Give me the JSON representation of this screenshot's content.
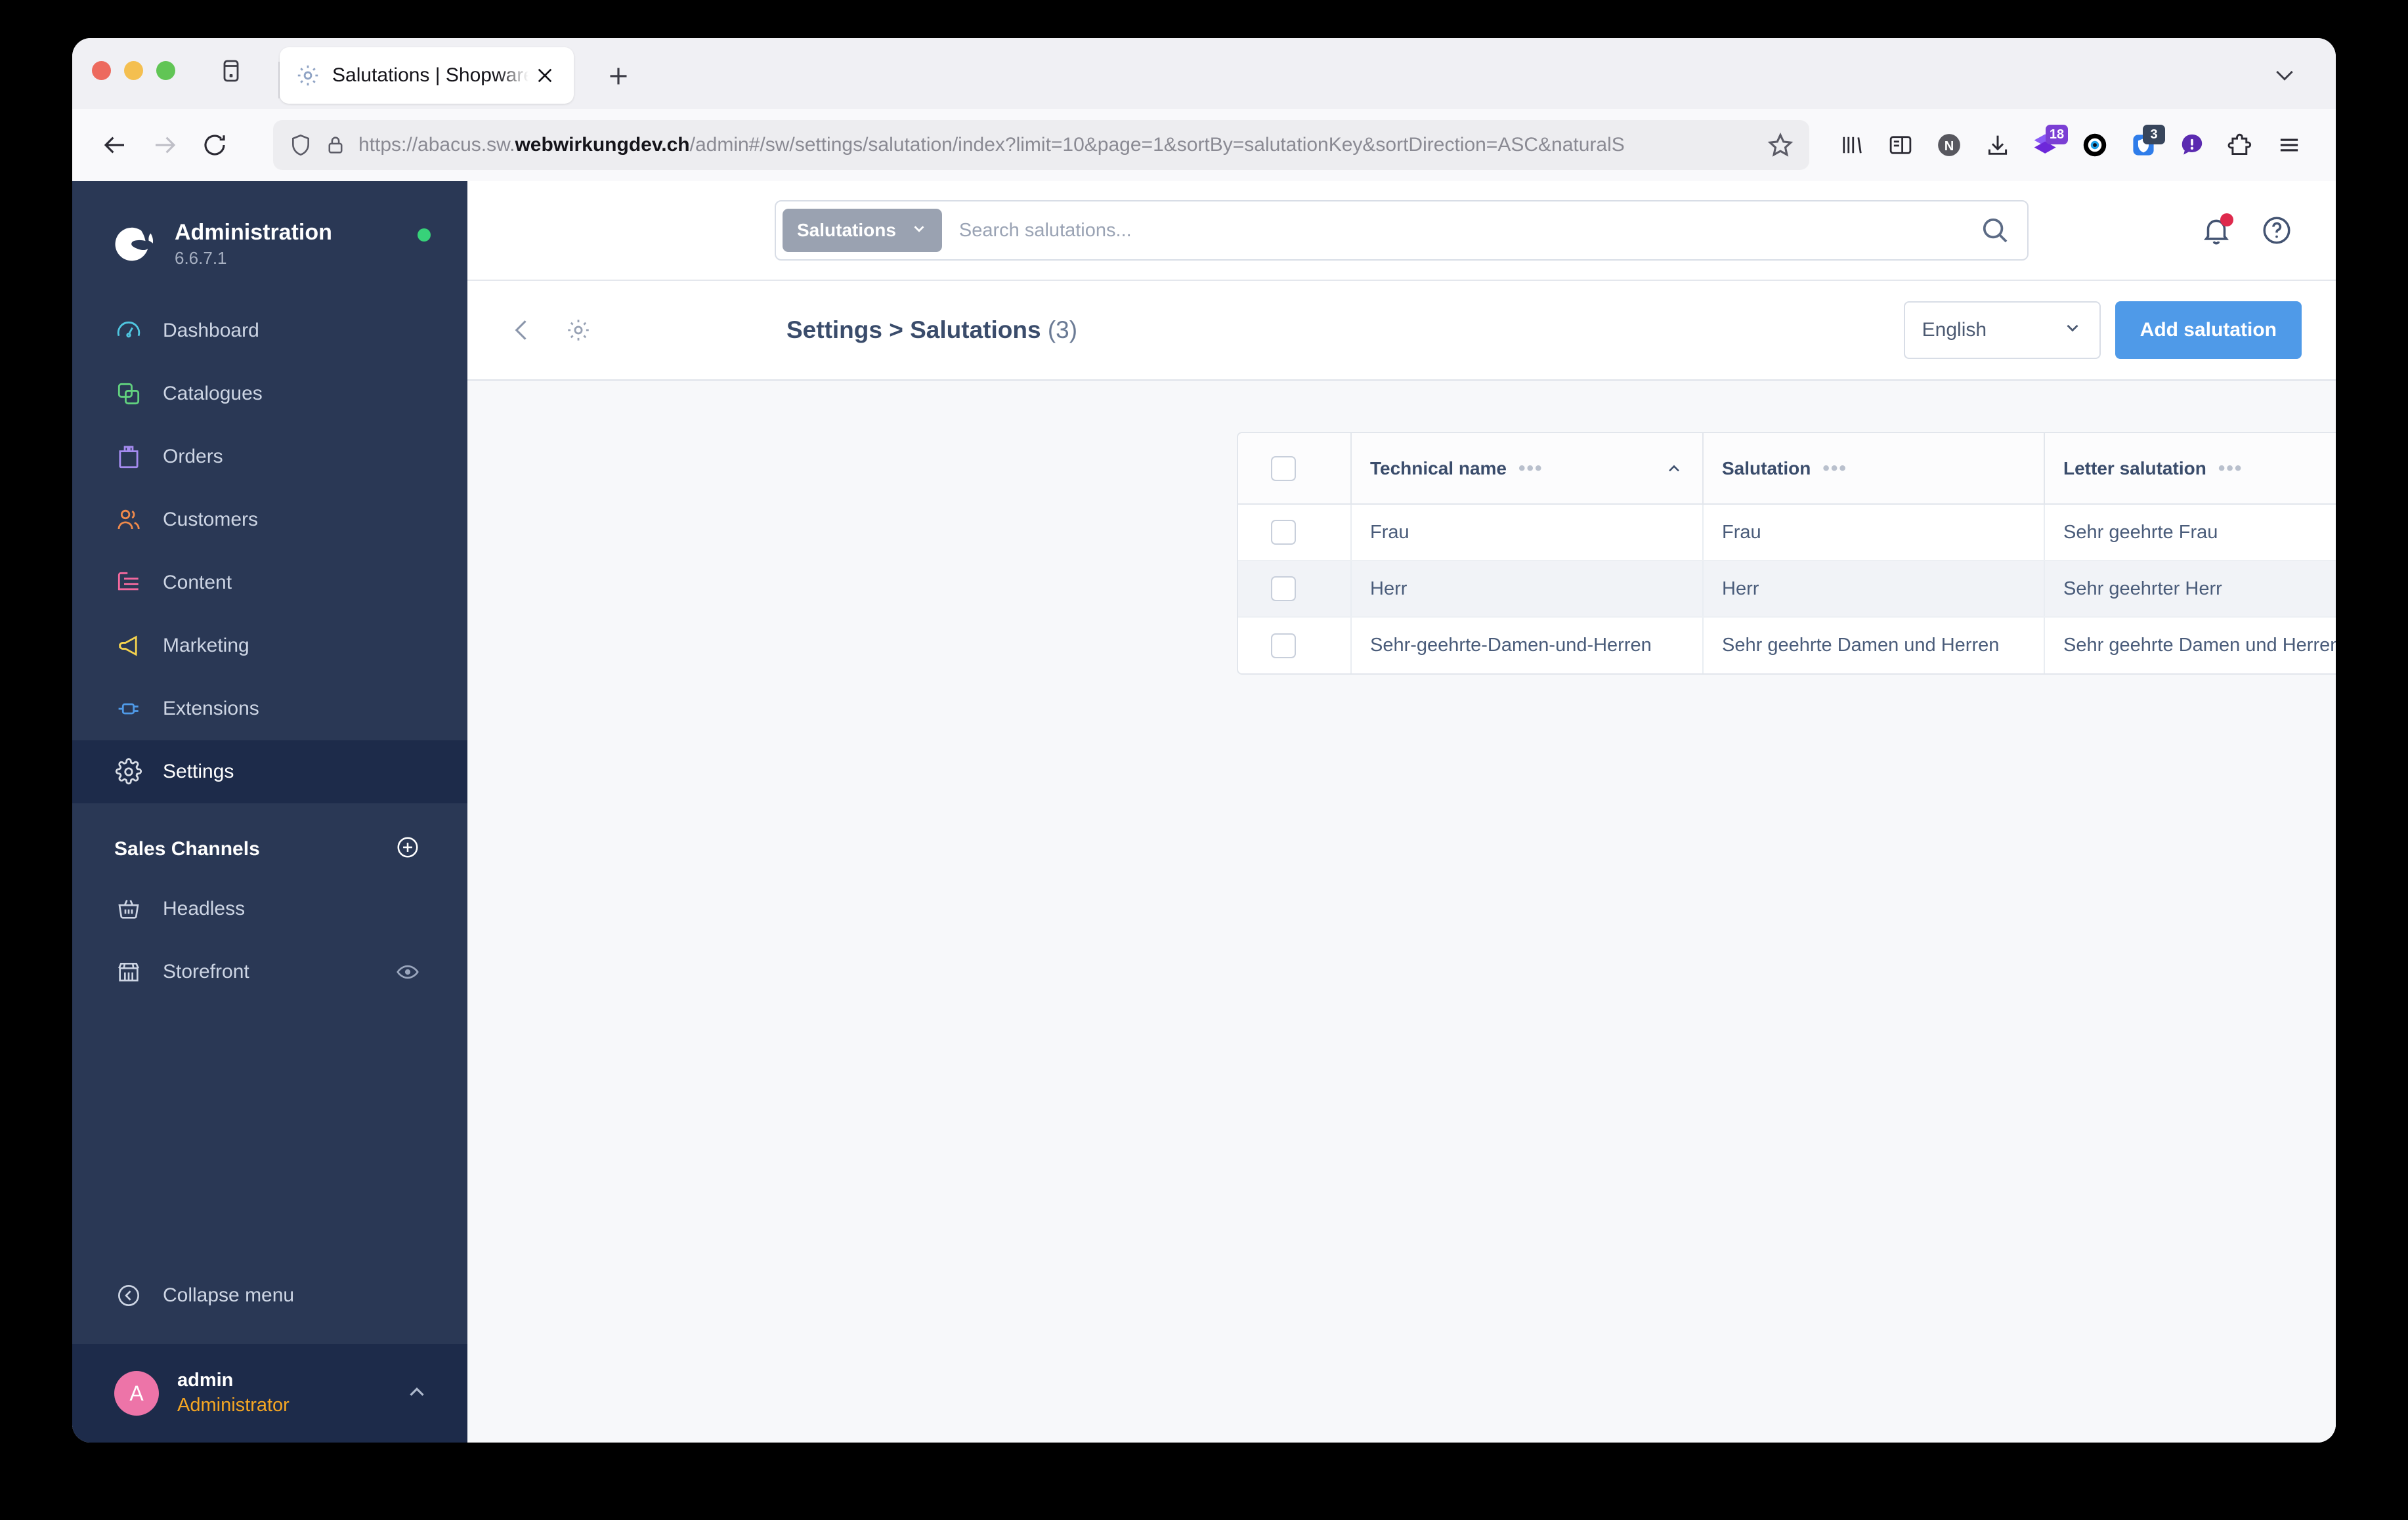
{
  "browser": {
    "tab": {
      "title": "Salutations | Shopware Administ",
      "favicon_icon": "gear-icon",
      "close_icon": "close-icon"
    },
    "new_tab_icon": "plus-icon",
    "tab_list_icon": "tab-list-icon",
    "window_chevron_icon": "chevron-down-icon",
    "nav": {
      "back_icon": "back-arrow-icon",
      "forward_icon": "forward-arrow-icon",
      "reload_icon": "reload-icon",
      "shield_icon": "shield-icon",
      "lock_icon": "padlock-icon",
      "star_icon": "star-icon",
      "url_prefix": "https://abacus.sw.",
      "url_domain": "webwirkungdev.ch",
      "url_suffix": "/admin#/sw/settings/salutation/index?limit=10&page=1&sortBy=salutationKey&sortDirection=ASC&naturalS"
    },
    "toolbar_icons": [
      {
        "name": "library-icon",
        "badge": ""
      },
      {
        "name": "sidebar-icon",
        "badge": ""
      },
      {
        "name": "notion-icon",
        "badge": ""
      },
      {
        "name": "downloads-icon",
        "badge": ""
      },
      {
        "name": "extension-purple-icon",
        "badge": "18",
        "badge_color": "#7b3fd4"
      },
      {
        "name": "eye-extension-icon",
        "badge": ""
      },
      {
        "name": "shield-extension-icon",
        "badge": "3",
        "badge_color": "#38465c"
      },
      {
        "name": "alert-extension-icon",
        "badge": ""
      },
      {
        "name": "puzzle-icon",
        "badge": ""
      },
      {
        "name": "app-menu-icon",
        "badge": ""
      }
    ]
  },
  "sidebar": {
    "title": "Administration",
    "version": "6.6.7.1",
    "status_dot_color": "#37d279",
    "logo_icon": "shopware-logo-icon",
    "items": [
      {
        "label": "Dashboard",
        "icon": "dashboard-icon",
        "color": "#4fc6e0",
        "active": false
      },
      {
        "label": "Catalogues",
        "icon": "catalogues-icon",
        "color": "#62d27f",
        "active": false
      },
      {
        "label": "Orders",
        "icon": "orders-icon",
        "color": "#a58bf0",
        "active": false
      },
      {
        "label": "Customers",
        "icon": "customers-icon",
        "color": "#f08a4b",
        "active": false
      },
      {
        "label": "Content",
        "icon": "content-icon",
        "color": "#f4699e",
        "active": false
      },
      {
        "label": "Marketing",
        "icon": "marketing-icon",
        "color": "#f5d34e",
        "active": false
      },
      {
        "label": "Extensions",
        "icon": "extensions-icon",
        "color": "#4f9ae8",
        "active": false
      },
      {
        "label": "Settings",
        "icon": "settings-gear-icon",
        "color": "#d8dde6",
        "active": true
      }
    ],
    "sales_channels": {
      "title": "Sales Channels",
      "add_icon": "plus-circle-icon",
      "items": [
        {
          "label": "Headless",
          "icon": "basket-icon",
          "trailing_icon": ""
        },
        {
          "label": "Storefront",
          "icon": "store-icon",
          "trailing_icon": "eye-icon"
        }
      ]
    },
    "collapse": {
      "label": "Collapse menu",
      "icon": "collapse-left-icon"
    },
    "user": {
      "avatar_initial": "A",
      "avatar_color": "#ed74a8",
      "name": "admin",
      "role": "Administrator",
      "role_color": "#f5a623",
      "chevron_icon": "chevron-up-icon"
    }
  },
  "topbar": {
    "scope_pill": "Salutations",
    "scope_chevron_icon": "chevron-down-icon",
    "search_placeholder": "Search salutations...",
    "search_value": "",
    "search_icon": "search-icon",
    "notification_icon": "bell-icon",
    "notification_dot_color": "#de294c",
    "help_icon": "help-circle-icon"
  },
  "pagehead": {
    "back_icon": "chevron-left-icon",
    "gear_icon": "gear-icon",
    "title": "Settings > Salutations",
    "count": "(3)",
    "language": "English",
    "language_chevron_icon": "chevron-down-icon",
    "add_button": "Add salutation",
    "add_button_color": "#4f9ae8"
  },
  "table": {
    "select_all_icon": "checkbox-icon",
    "column_settings_icon": "column-settings-icon",
    "columns": [
      {
        "label": "Technical name",
        "menu_icon": "ellipsis-icon",
        "sorted": true,
        "sort_icon": "chevron-up-icon"
      },
      {
        "label": "Salutation",
        "menu_icon": "ellipsis-icon",
        "sorted": false,
        "sort_icon": ""
      },
      {
        "label": "Letter salutation",
        "menu_icon": "ellipsis-icon",
        "sorted": false,
        "sort_icon": ""
      }
    ],
    "rows": [
      {
        "technical_name": "Frau",
        "salutation": "Frau",
        "letter_salutation": "Sehr geehrte Frau",
        "actions_icon": "ellipsis-icon",
        "hover": false
      },
      {
        "technical_name": "Herr",
        "salutation": "Herr",
        "letter_salutation": "Sehr geehrter Herr",
        "actions_icon": "ellipsis-icon",
        "hover": true
      },
      {
        "technical_name": "Sehr-geehrte-Damen-und-Herren",
        "salutation": "Sehr geehrte Damen und Herren",
        "letter_salutation": "Sehr geehrte Damen und Herren",
        "actions_icon": "ellipsis-icon",
        "hover": false
      }
    ]
  }
}
